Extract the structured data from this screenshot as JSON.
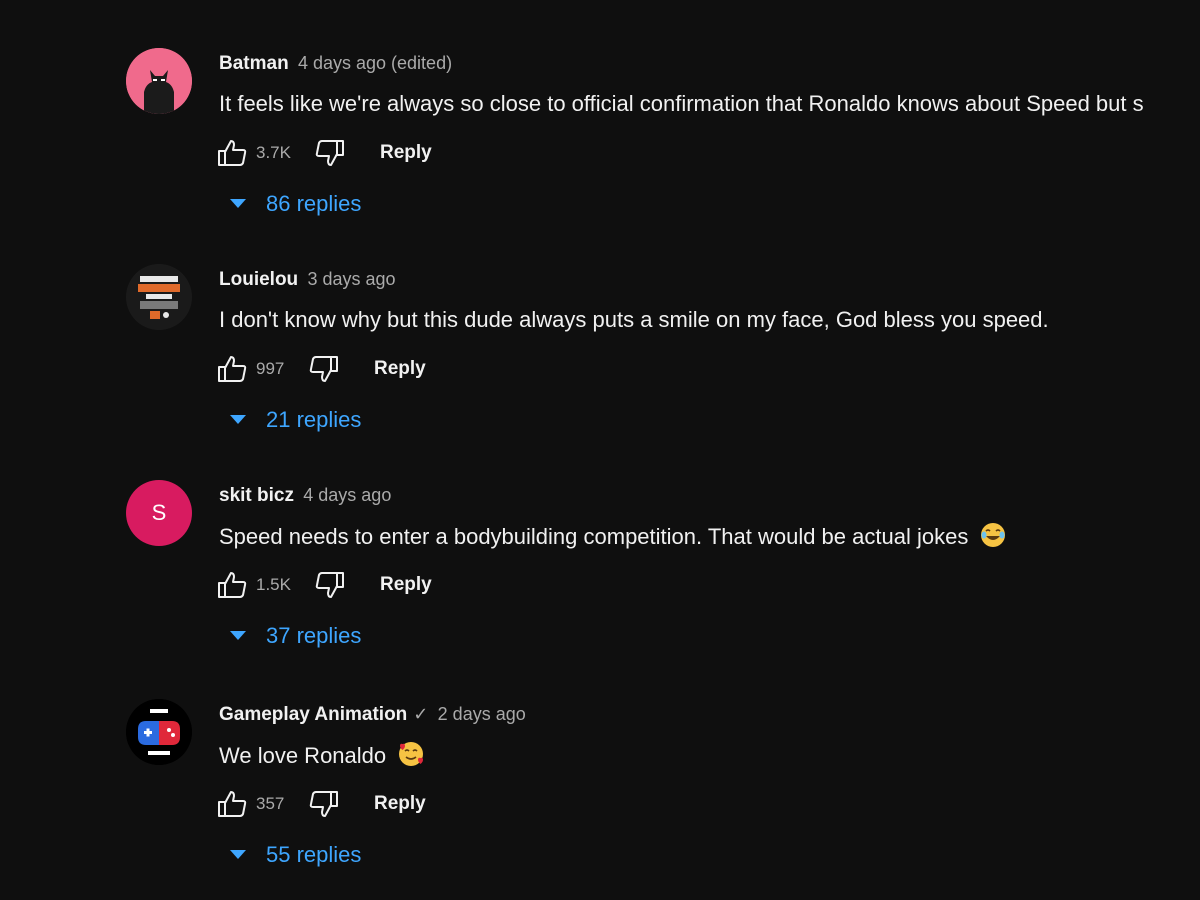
{
  "comments": [
    {
      "avatar": {
        "kind": "image",
        "icon": "batman-avatar-icon",
        "color": "#f06a8c"
      },
      "author": "Batman",
      "verified": false,
      "time": "4 days ago (edited)",
      "text": "It feels like we're always so close to official confirmation that Ronaldo knows about Speed but s",
      "emoji": "",
      "likes": "3.7K",
      "reply_label": "Reply",
      "replies_label": "86 replies"
    },
    {
      "avatar": {
        "kind": "image",
        "icon": "channel-logo-avatar-icon",
        "color": "#1a1a1a"
      },
      "author": "Louielou",
      "verified": false,
      "time": "3 days ago",
      "text": "I don't know why but this dude always puts a smile on my face, God bless you speed.",
      "emoji": "",
      "likes": "997",
      "reply_label": "Reply",
      "replies_label": "21 replies"
    },
    {
      "avatar": {
        "kind": "letter",
        "letter": "S",
        "color": "#d81b60"
      },
      "author": "skit bicz",
      "verified": false,
      "time": "4 days ago",
      "text": "Speed needs to enter a bodybuilding competition. That would be actual jokes",
      "emoji": "laughing-tears-emoji",
      "likes": "1.5K",
      "reply_label": "Reply",
      "replies_label": "37 replies"
    },
    {
      "avatar": {
        "kind": "image",
        "icon": "gamepad-avatar-icon",
        "color": "#000000"
      },
      "author": "Gameplay Animation",
      "verified": true,
      "time": "2 days ago",
      "text": "We love Ronaldo",
      "emoji": "smiling-hearts-emoji",
      "likes": "357",
      "reply_label": "Reply",
      "replies_label": "55 replies"
    }
  ],
  "colors": {
    "background": "#0f0f0f",
    "text": "#f1f1f1",
    "secondary": "#aaaaaa",
    "link": "#3ea6ff"
  }
}
